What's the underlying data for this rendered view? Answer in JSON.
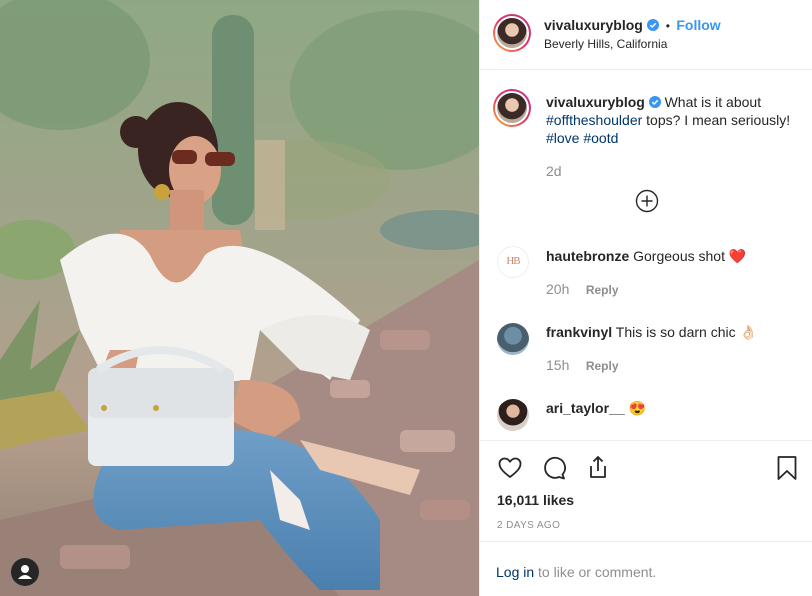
{
  "post": {
    "username": "vivaluxuryblog",
    "location": "Beverly Hills, California",
    "follow_label": "Follow",
    "separator": "•"
  },
  "caption": {
    "username": "vivaluxuryblog",
    "text_1": "What is it about",
    "hashtag_1": "#offtheshoulder",
    "text_2": "tops? I mean seriously!",
    "hashtag_2": "#love",
    "hashtag_3": "#ootd",
    "age": "2d"
  },
  "comments": [
    {
      "username": "hautebronze",
      "text": "Gorgeous shot",
      "emoji": "❤️",
      "age": "20h",
      "reply_label": "Reply",
      "avatar_text": "HB"
    },
    {
      "username": "frankvinyl",
      "text": "This is so darn chic",
      "emoji": "👌🏻",
      "age": "15h",
      "reply_label": "Reply"
    },
    {
      "username": "ari_taylor__",
      "text": "",
      "emoji": "😍"
    }
  ],
  "stats": {
    "likes": "16,011 likes",
    "date": "2 DAYS AGO"
  },
  "footer": {
    "login_label": "Log in",
    "login_suffix": "to like or comment."
  },
  "icons": {
    "verified": "verified-badge-icon",
    "load_more": "plus-circle-icon",
    "like": "heart-icon",
    "comment": "comment-bubble-icon",
    "share": "share-icon",
    "save": "bookmark-icon",
    "user": "user-silhouette-icon"
  },
  "colors": {
    "link": "#3897f0",
    "hashtag": "#003569",
    "verified": "#3897f0",
    "muted": "#8e8e8e"
  }
}
